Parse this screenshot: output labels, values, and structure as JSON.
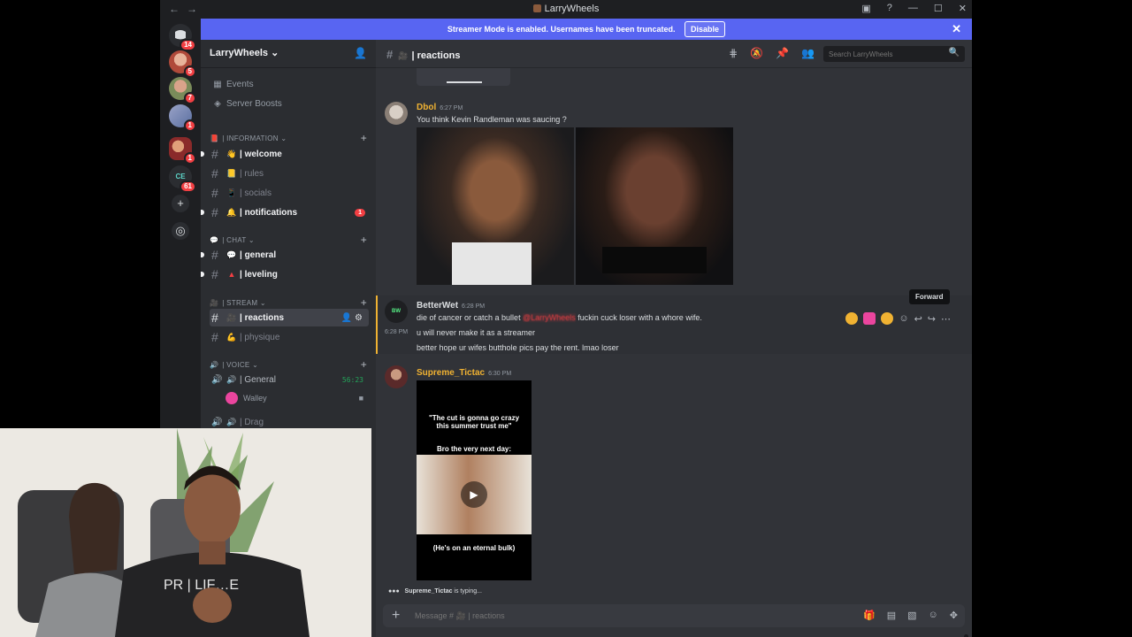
{
  "window": {
    "title": "LarryWheels"
  },
  "banner": {
    "text": "Streamer Mode is enabled. Usernames have been truncated.",
    "disable": "Disable"
  },
  "rail": {
    "badges": [
      "14",
      "5",
      "7",
      "1",
      "1",
      "61"
    ]
  },
  "guild": {
    "name": "LarryWheels ⌄"
  },
  "sidebar": {
    "events": "Events",
    "boosts": "Server Boosts",
    "cat_information": "| INFORMATION ⌄",
    "cat_chat": "| CHAT ⌄",
    "cat_stream": "| STREAM ⌄",
    "cat_voice": "| VOICE ⌄",
    "channels": {
      "welcome": "| welcome",
      "rules": "| rules",
      "socials": "| socials",
      "notifications": "| notifications",
      "notifications_badge": "1",
      "general": "| general",
      "leveling": "| leveling",
      "reactions": "| reactions",
      "physique": "| physique",
      "voice_general": "| General",
      "voice_time": "56:23",
      "voice_user": "Walley",
      "voice_drag": "| Drag"
    }
  },
  "header": {
    "channel": "| reactions",
    "search_placeholder": "Search LarryWheels"
  },
  "messages": {
    "m1": {
      "author": "Dbol",
      "time": "6:27 PM",
      "text": "You think Kevin Randleman was saucing ?"
    },
    "m2": {
      "author": "BetterWet",
      "time": "6:28 PM",
      "line1a": "die of cancer or catch a bullet",
      "mention": "@LarryWheels",
      "line1b": "fuckin cuck loser with a whore wife.",
      "side_time": "6:28 PM",
      "line2": "u will never make it as a streamer",
      "line3": "better hope ur wifes butthole pics pay the rent. lmao loser"
    },
    "tooltip": "Forward",
    "m3": {
      "author": "Supreme_Tictac",
      "time": "6:30 PM",
      "meme_top": "\"The cut is gonna go crazy this summer trust me\"",
      "meme_mid": "Bro the very next day:",
      "meme_bottom": "(He's on an eternal bulk)"
    }
  },
  "typing": {
    "user": "Supreme_Tictac",
    "text": " is typing..."
  },
  "composer": {
    "placeholder": "Message # 🎥 | reactions"
  },
  "webcam": {
    "shirt_text": "PR | LIF…E"
  },
  "colors": {
    "blurple": "#5865f2",
    "mention_red": "#f23f43",
    "author_gold": "#f0b232"
  }
}
